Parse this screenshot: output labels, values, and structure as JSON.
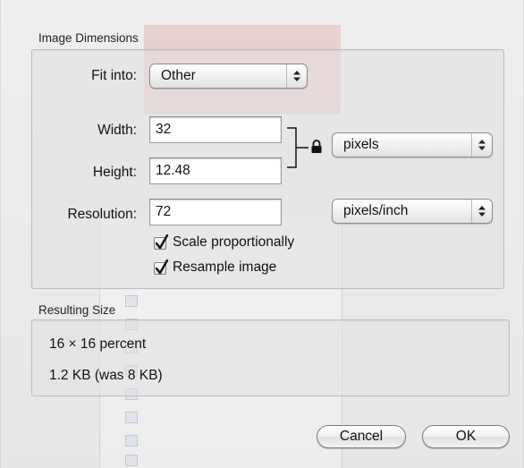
{
  "image_dimensions": {
    "section_title": "Image Dimensions",
    "fit_into": {
      "label": "Fit into:",
      "selected": "Other"
    },
    "width": {
      "label": "Width:",
      "value": "32"
    },
    "height": {
      "label": "Height:",
      "value": "12.48"
    },
    "size_unit": {
      "selected": "pixels"
    },
    "resolution": {
      "label": "Resolution:",
      "value": "72",
      "unit_selected": "pixels/inch"
    },
    "scale_proportionally": {
      "label": "Scale proportionally",
      "checked": true
    },
    "resample_image": {
      "label": "Resample image",
      "checked": true
    }
  },
  "resulting_size": {
    "section_title": "Resulting Size",
    "dimensions_text": "16 × 16 percent",
    "file_size_text": "1.2 KB (was 8 KB)"
  },
  "buttons": {
    "cancel_label": "Cancel",
    "ok_label": "OK"
  },
  "icons": {
    "lock": "lock-icon",
    "popup_arrows": "up-down-arrows-icon",
    "checkmark": "checkmark-icon"
  },
  "colors": {
    "dialog_background": "#ececec",
    "group_border": "#bdbdbd",
    "watermark_red": "#d62b2b"
  }
}
